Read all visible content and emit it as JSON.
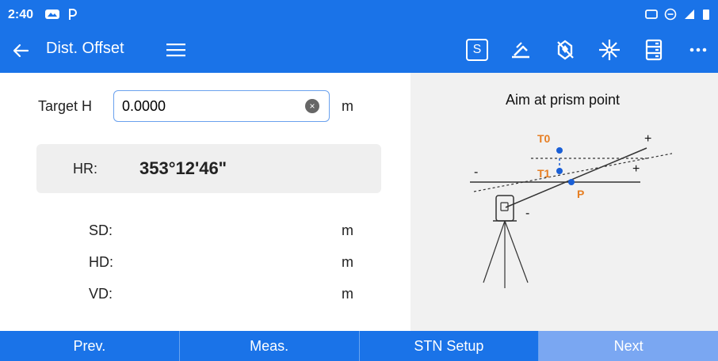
{
  "status": {
    "time": "2:40",
    "left_icons": [
      "cloud-icon",
      "p-icon"
    ],
    "right_icons": [
      "cast-icon",
      "do-not-disturb-icon",
      "signal-icon",
      "battery-icon"
    ]
  },
  "appbar": {
    "back_icon": "back-arrow-icon",
    "title": "Dist. Offset",
    "menu_icon": "hamburger-icon",
    "tools": {
      "s_label": "S",
      "icons": [
        "laser-icon",
        "no-prism-icon",
        "target-icon",
        "storage-icon",
        "more-icon"
      ]
    }
  },
  "left": {
    "target_h_label": "Target H",
    "target_h_value": "0.0000",
    "unit_m": "m",
    "hr_label": "HR:",
    "hr_value": "353°12'46\"",
    "sd_label": "SD:",
    "hd_label": "HD:",
    "vd_label": "VD:"
  },
  "right": {
    "instruction": "Aim at prism point",
    "diagram_labels": {
      "t0": "T0",
      "t1": "T1",
      "p": "P",
      "plus1": "+",
      "plus2": "+",
      "minus1": "-",
      "minus2": "-"
    }
  },
  "bottom": {
    "prev": "Prev.",
    "meas": "Meas.",
    "stn_setup": "STN Setup",
    "next": "Next"
  },
  "colors": {
    "primary": "#1a73e8",
    "next_button": "#7aa7f2",
    "accent_orange": "#e67e22",
    "point_blue": "#1a5fd6"
  }
}
